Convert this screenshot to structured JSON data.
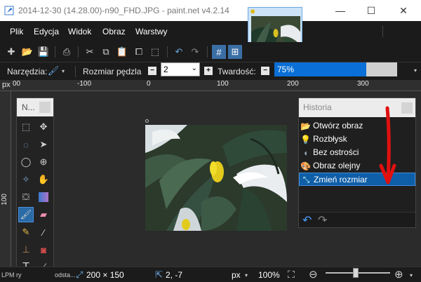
{
  "window": {
    "title": "2014-12-30 (14.28.00)-n90_FHD.JPG - paint.net v4.2.14",
    "minimize_glyph": "—",
    "maximize_glyph": "☐",
    "close_glyph": "✕"
  },
  "menu": [
    "Plik",
    "Edycja",
    "Widok",
    "Obraz",
    "Warstwy"
  ],
  "tool_options": {
    "tools_label": "Narzędzia:",
    "brush_size_label": "Rozmiar pędzla",
    "brush_size_value": "2",
    "hardness_label": "Twardość:",
    "hardness_value_text": "75%",
    "hardness_fraction": 0.75,
    "minus_glyph": "−",
    "plus_glyph": "+"
  },
  "ruler": {
    "unit": "px",
    "ticks": [
      "00",
      "-100",
      "0",
      "100",
      "200",
      "300"
    ],
    "vertical_tick": "100"
  },
  "tools_panel": {
    "title": "N..."
  },
  "history": {
    "title": "Historia",
    "items": [
      {
        "label": "Otwórz obraz",
        "icon": "folder-icon"
      },
      {
        "label": "Rozbłysk",
        "icon": "lightbulb-icon"
      },
      {
        "label": "Bez ostrości",
        "icon": "blur-icon"
      },
      {
        "label": "Obraz olejny",
        "icon": "palette-icon"
      },
      {
        "label": "Zmień rozmiar",
        "icon": "resize-icon",
        "selected": true
      }
    ]
  },
  "status": {
    "left_text": "LPM ry",
    "left_text2": "odsta...",
    "image_size": "200 × 150",
    "cursor_pos": "2, -7",
    "unit": "px",
    "zoom": "100%",
    "zoom_fraction": 0.47
  },
  "colors": {
    "accent": "#0f5ea8",
    "arrow": "#e01010",
    "menubar": "#1b1b1b"
  }
}
